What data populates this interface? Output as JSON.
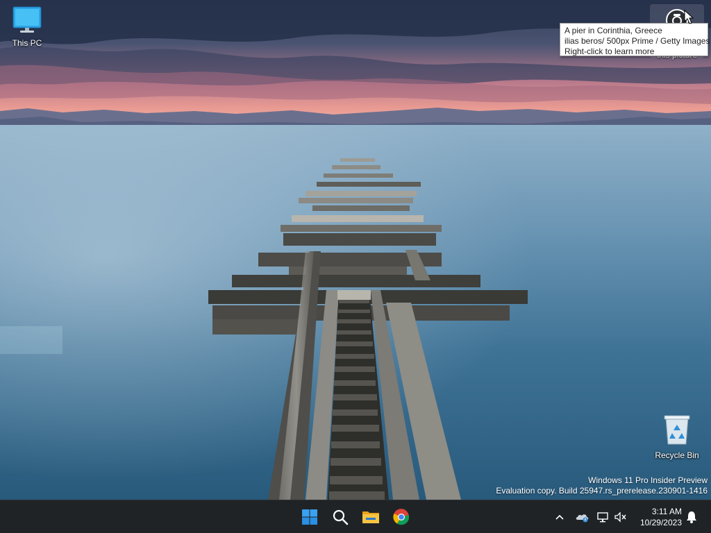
{
  "desktop": {
    "icons": [
      {
        "label": "This PC",
        "icon": "computer-monitor-icon"
      },
      {
        "label": "Recycle Bin",
        "icon": "recycle-bin-icon"
      }
    ],
    "learn_about_picture": {
      "label": "this picture",
      "icon": "camera-icon"
    },
    "tooltip": {
      "line1": "A pier in Corinthia, Greece",
      "line2": "ilias beros/ 500px Prime / Getty Images",
      "line3": "Right-click to learn more"
    },
    "watermark": {
      "line1": "Windows 11 Pro Insider Preview",
      "line2": "Evaluation copy. Build 25947.rs_prerelease.230901-1416"
    }
  },
  "taskbar": {
    "pinned": [
      {
        "name": "Start",
        "icon": "windows-logo-icon"
      },
      {
        "name": "Search",
        "icon": "search-icon"
      },
      {
        "name": "File Explorer",
        "icon": "folder-icon"
      },
      {
        "name": "Google Chrome",
        "icon": "chrome-icon"
      }
    ],
    "tray": {
      "icons": [
        "chevron-up-icon",
        "onedrive-icon",
        "network-icon",
        "volume-muted-icon",
        "bell-icon"
      ],
      "time": "3:11 AM",
      "date": "10/29/2023"
    }
  },
  "colors": {
    "taskbar_bg": "#1f2326",
    "windows_blue": "#1e90ff",
    "folder_yellow": "#f3b82c"
  }
}
